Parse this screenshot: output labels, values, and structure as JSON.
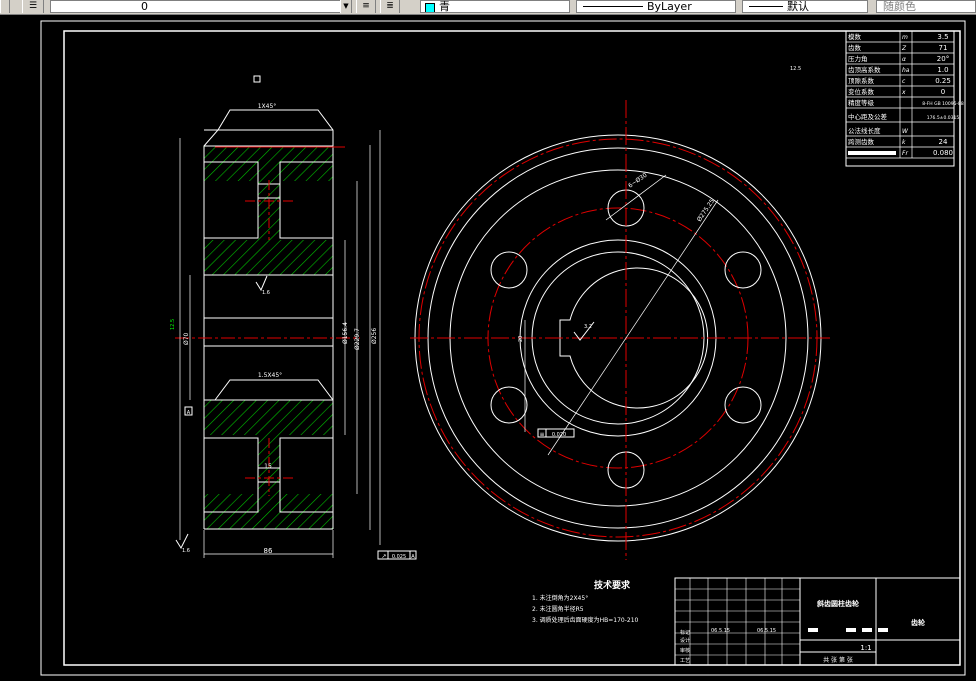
{
  "toolbar": {
    "layer_value": "0",
    "color_value": "青",
    "linetype_value": "ByLayer",
    "lineweight_value": "默认",
    "plotstyle_value": "随颜色"
  },
  "drawing": {
    "dims": {
      "chamfer_top": "1X45°",
      "chamfer_mid": "1.5X45°",
      "width": "86",
      "face_runout": "0.025",
      "datum_a": "A",
      "roughness_main": "1.6",
      "roughness_bottom": "1.6",
      "roughness_hub": "3.2",
      "roughness_other": "12.5",
      "hole_dia": "6~Ø30",
      "pcd": "Ø275.25",
      "dia_bore": "Ø70",
      "dia_mid": "Ø156.4",
      "dia_root": "Ø229.7",
      "dia_tip": "Ø256",
      "keyway_depth": "76.9",
      "keyway_width": "20",
      "hub_width": "15",
      "key_tol": "0.020"
    },
    "param_table": {
      "rows": [
        {
          "label": "模数",
          "sym": "m",
          "value": "3.5"
        },
        {
          "label": "齿数",
          "sym": "Z",
          "value": "71"
        },
        {
          "label": "压力角",
          "sym": "α",
          "value": "20°"
        },
        {
          "label": "齿顶高系数",
          "sym": "ha",
          "value": "1.0"
        },
        {
          "label": "顶隙系数",
          "sym": "c",
          "value": "0.25"
        },
        {
          "label": "变位系数",
          "sym": "x",
          "value": "0"
        },
        {
          "label": "精度等级",
          "sym": "",
          "value": "8-FH GB 10095-88"
        },
        {
          "label": "中心距及公差",
          "sym": "",
          "value": "176.5±0.0315"
        },
        {
          "label": "公法线长度",
          "sym": "W",
          "value": ""
        },
        {
          "label": "跨测齿数",
          "sym": "k",
          "value": "24"
        },
        {
          "label": "",
          "sym": "Fr",
          "value": "0.080"
        }
      ],
      "paired_gear": "配对齿轮",
      "pair_no": "图号"
    },
    "tech_req": {
      "title": "技术要求",
      "items": [
        "1.  未注倒角为2X45°",
        "2.  未注圆角半径R5",
        "3.  调质处理后齿面硬度为HB=170-210"
      ]
    },
    "title_block": {
      "part_name": "斜齿圆柱齿轮",
      "company": "齿轮",
      "scale": "1:1",
      "sheet_label": "共 张 第 张",
      "row_labels": [
        "标记",
        "设计",
        "审核",
        "工艺"
      ],
      "date_a": "06.5.15",
      "date_b": "06.5.15"
    }
  }
}
